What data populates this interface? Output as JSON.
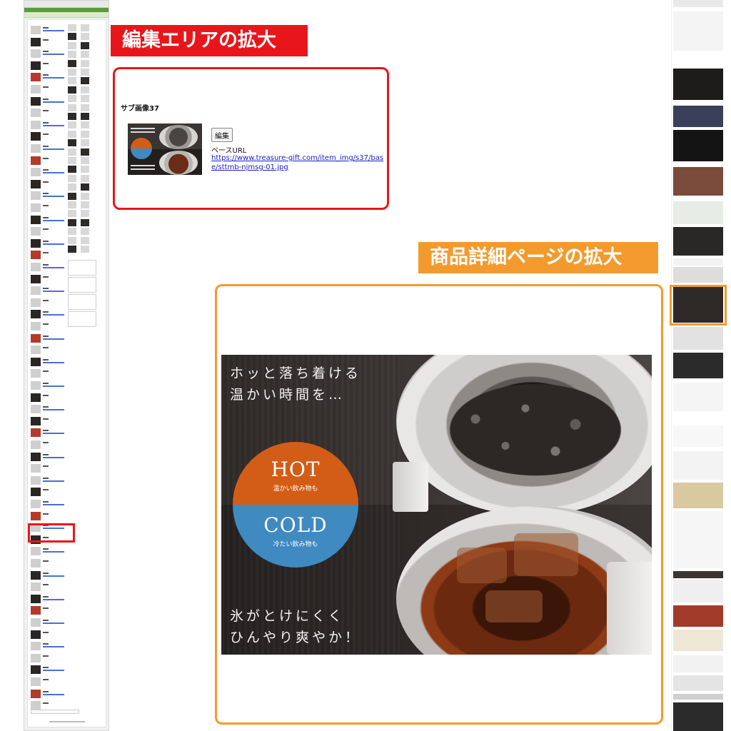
{
  "headings": {
    "edit_area": "編集エリアの拡大",
    "detail_page": "商品詳細ページの拡大"
  },
  "edit_area": {
    "title": "サブ画像37",
    "edit_button": "編集",
    "base_url_label": "ベースURL",
    "base_url_link": "https://www.treasure-gift.com/item_img/s37/base/sttmb-njmsg-01.jpg"
  },
  "product_image": {
    "hot_text_line1": "ホッと落ち着ける",
    "hot_text_line2": "温かい時間を…",
    "hot_label": "HOT",
    "hot_sub": "温かい飲み物も",
    "cold_label": "COLD",
    "cold_sub": "冷たい飲み物も",
    "cold_text_line1": "氷がとけにくく",
    "cold_text_line2": "ひんやり爽やか！"
  },
  "colors": {
    "edit_accent": "#e8161b",
    "detail_accent": "#f39a2e",
    "hot_orange": "#d35d17",
    "cold_blue": "#3f8ac1",
    "link_blue": "#1a1acf"
  }
}
